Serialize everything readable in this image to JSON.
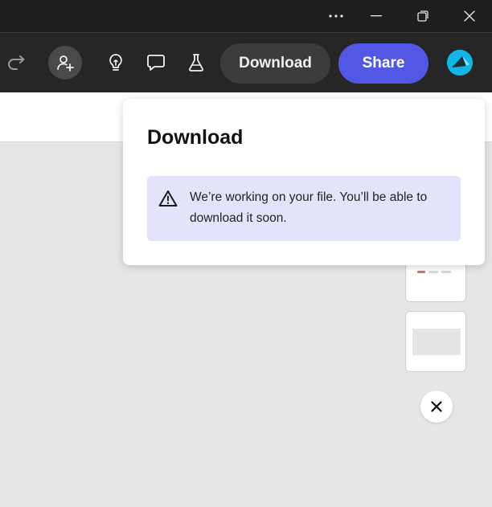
{
  "toolbar": {
    "download_label": "Download",
    "share_label": "Share"
  },
  "popover": {
    "title": "Download",
    "notice_text": "We’re working on your file. You’ll be able to download it soon."
  },
  "icons": {
    "more": "more-horizontal-icon",
    "minimize": "minimize-icon",
    "restore": "restore-icon",
    "close": "close-icon",
    "redo": "redo-icon",
    "invite": "add-user-icon",
    "ideas": "lightbulb-icon",
    "comments": "comment-icon",
    "labs": "flask-icon",
    "warning": "warning-icon"
  },
  "colors": {
    "titlebar": "#1f1f1f",
    "toolbar": "#262626",
    "download_button": "#3c3c3c",
    "share_button": "#5258e4",
    "notice_bg": "#e3e4fb",
    "avatar": "#10b7e6",
    "canvas": "#e6e6e6"
  }
}
